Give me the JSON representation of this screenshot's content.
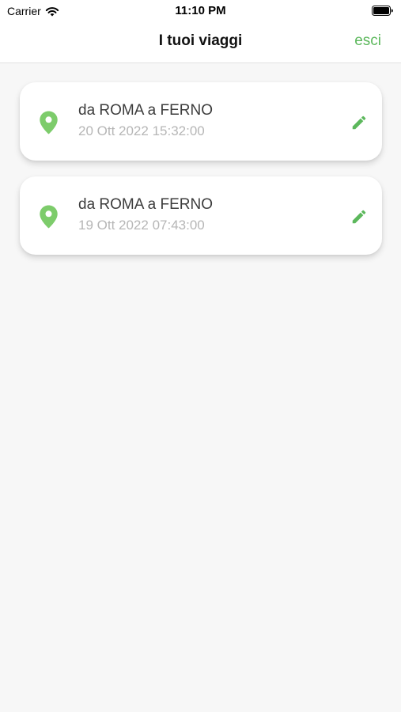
{
  "status_bar": {
    "carrier": "Carrier",
    "time": "11:10 PM"
  },
  "nav": {
    "title": "I tuoi viaggi",
    "action_label": "esci"
  },
  "trips": [
    {
      "route": "da ROMA a FERNO",
      "date": "20 Ott 2022 15:32:00"
    },
    {
      "route": "da ROMA a FERNO",
      "date": "19 Ott 2022 07:43:00"
    }
  ],
  "icons": {
    "status_bar": [
      "wifi-icon",
      "battery-icon"
    ],
    "trip_card": [
      "location-pin-icon",
      "pencil-edit-icon"
    ]
  },
  "colors": {
    "accent": "#5cb85c",
    "pin": "#7dcc6b",
    "background": "#f7f7f7",
    "card": "#ffffff"
  }
}
